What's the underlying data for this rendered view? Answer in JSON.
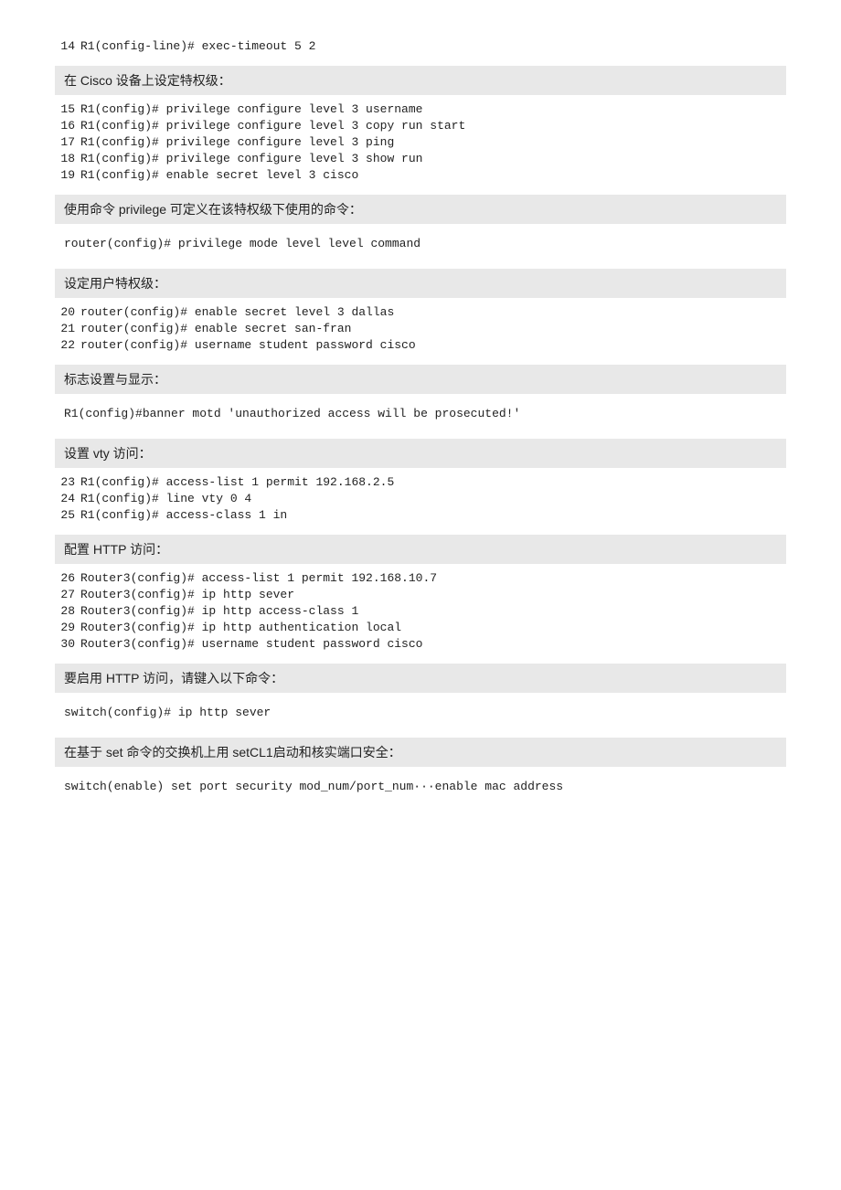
{
  "topCommand": {
    "lineNum": "14",
    "text": "R1(config-line)# exec-timeout 5 2"
  },
  "sections": [
    {
      "id": "s1",
      "header": "在 Cisco 设备上设定特权级：",
      "lines": [
        {
          "num": "15",
          "text": "R1(config)# privilege configure level 3 username"
        },
        {
          "num": "16",
          "text": "R1(config)# privilege configure level 3 copy run start"
        },
        {
          "num": "17",
          "text": "R1(config)# privilege configure level 3 ping"
        },
        {
          "num": "18",
          "text": "R1(config)# privilege configure level 3 show run"
        },
        {
          "num": "19",
          "text": "R1(config)# enable secret level 3 cisco"
        }
      ]
    },
    {
      "id": "s2",
      "header": "使用命令 privilege 可定义在该特权级下使用的命令：",
      "prose": "router(config)# privilege mode level level command"
    },
    {
      "id": "s3",
      "header": "设定用户特权级：",
      "lines": [
        {
          "num": "20",
          "text": "router(config)# enable secret level 3 dallas"
        },
        {
          "num": "21",
          "text": "router(config)# enable secret san-fran"
        },
        {
          "num": "22",
          "text": "router(config)# username student password cisco"
        }
      ]
    },
    {
      "id": "s4",
      "header": "标志设置与显示：",
      "prose": "R1(config)#banner motd  'unauthorized access will be prosecuted!'"
    },
    {
      "id": "s5",
      "header": "设置 vty 访问：",
      "lines": [
        {
          "num": "23",
          "text": "R1(config)# access-list 1 permit 192.168.2.5"
        },
        {
          "num": "24",
          "text": "R1(config)# line vty 0 4"
        },
        {
          "num": "25",
          "text": "R1(config)# access-class 1 in"
        }
      ]
    },
    {
      "id": "s6",
      "header": "配置 HTTP 访问：",
      "lines": [
        {
          "num": "26",
          "text": "Router3(config)# access-list 1 permit 192.168.10.7"
        },
        {
          "num": "27",
          "text": "Router3(config)# ip http sever"
        },
        {
          "num": "28",
          "text": "Router3(config)# ip http access-class 1"
        },
        {
          "num": "29",
          "text": "Router3(config)# ip http authentication local"
        },
        {
          "num": "30",
          "text": "Router3(config)# username student password cisco"
        }
      ]
    },
    {
      "id": "s7",
      "header": "要启用 HTTP 访问，请键入以下命令：",
      "prose": "switch(config)# ip http sever"
    },
    {
      "id": "s8",
      "header": "在基于 set 命令的交换机上用 setCL1启动和核实端口安全：",
      "prose": "switch(enable) set port security mod_num/port_num···enable mac address"
    }
  ]
}
